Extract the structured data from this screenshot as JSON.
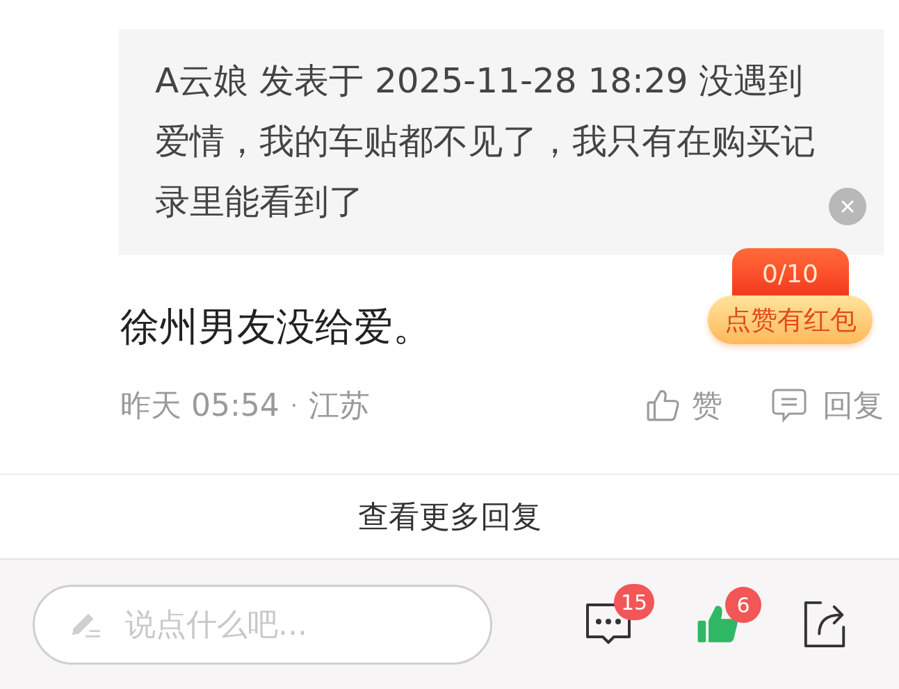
{
  "quote": {
    "text": "A云娘 发表于 2025-11-28 18:29 没遇到爱情，我的车贴都不见了，我只有在购买记录里能看到了"
  },
  "reward_badge": {
    "count": "0/10",
    "label": "点赞有红包"
  },
  "comment": {
    "text": "徐州男友没给爱。",
    "time": "昨天 05:54",
    "separator": "·",
    "location": "江苏",
    "like_label": "赞",
    "reply_label": "回复"
  },
  "more_replies": "查看更多回复",
  "bottom_bar": {
    "input": {
      "placeholder": "说点什么吧..."
    },
    "comment_count": "15",
    "like_count": "6",
    "liked": true
  }
}
